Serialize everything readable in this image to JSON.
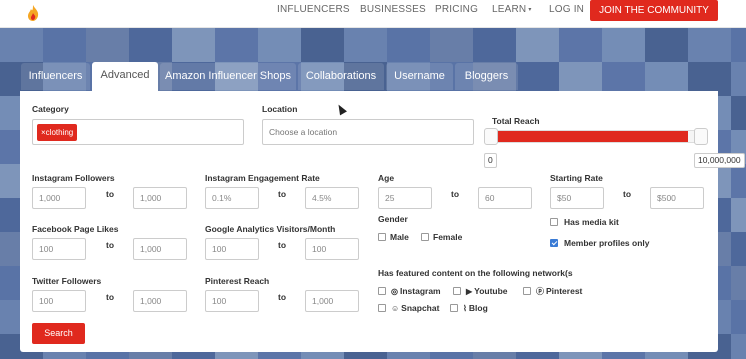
{
  "nav": {
    "links": [
      "INFLUENCERS",
      "BUSINESSES",
      "PRICING",
      "LEARN",
      "LOG IN"
    ],
    "learn_caret": "▾",
    "join": "JOIN THE COMMUNITY"
  },
  "tabs": [
    "Influencers",
    "Advanced",
    "Amazon Influencer Shops",
    "Collaborations",
    "Username",
    "Bloggers"
  ],
  "active_tab": "Advanced",
  "form": {
    "category": {
      "label": "Category",
      "chip": "×clothing"
    },
    "location": {
      "label": "Location",
      "placeholder": "Choose a location"
    },
    "total_reach": {
      "label": "Total Reach",
      "min": "0",
      "max": "10,000,000",
      "fill_fraction": 0.97
    },
    "to": "to",
    "instagram_followers": {
      "label": "Instagram Followers",
      "min": "1,000",
      "max": "1,000"
    },
    "instagram_engagement": {
      "label": "Instagram Engagement Rate",
      "min": "0.1%",
      "max": "4.5%"
    },
    "age": {
      "label": "Age",
      "min": "25",
      "max": "60"
    },
    "starting_rate": {
      "label": "Starting Rate",
      "min": "$50",
      "max": "$500"
    },
    "facebook_likes": {
      "label": "Facebook Page Likes",
      "min": "100",
      "max": "1,000"
    },
    "google_analytics": {
      "label": "Google Analytics Visitors/Month",
      "min": "100",
      "max": "100"
    },
    "gender": {
      "label": "Gender",
      "male": "Male",
      "female": "Female"
    },
    "has_media_kit": "Has media kit",
    "member_profiles_only": "Member profiles only",
    "twitter_followers": {
      "label": "Twitter Followers",
      "min": "100",
      "max": "1,000"
    },
    "pinterest_reach": {
      "label": "Pinterest Reach",
      "min": "100",
      "max": "1,000"
    },
    "featured": {
      "label": "Has featured content on the following network(s",
      "networks": [
        "Instagram",
        "Youtube",
        "Pinterest",
        "Snapchat",
        "Blog"
      ]
    },
    "search_button": "Search"
  },
  "colors": {
    "accent": "#e0291e",
    "hero_bg": "#5470a2",
    "checkbox_on": "#3a7bd5"
  }
}
